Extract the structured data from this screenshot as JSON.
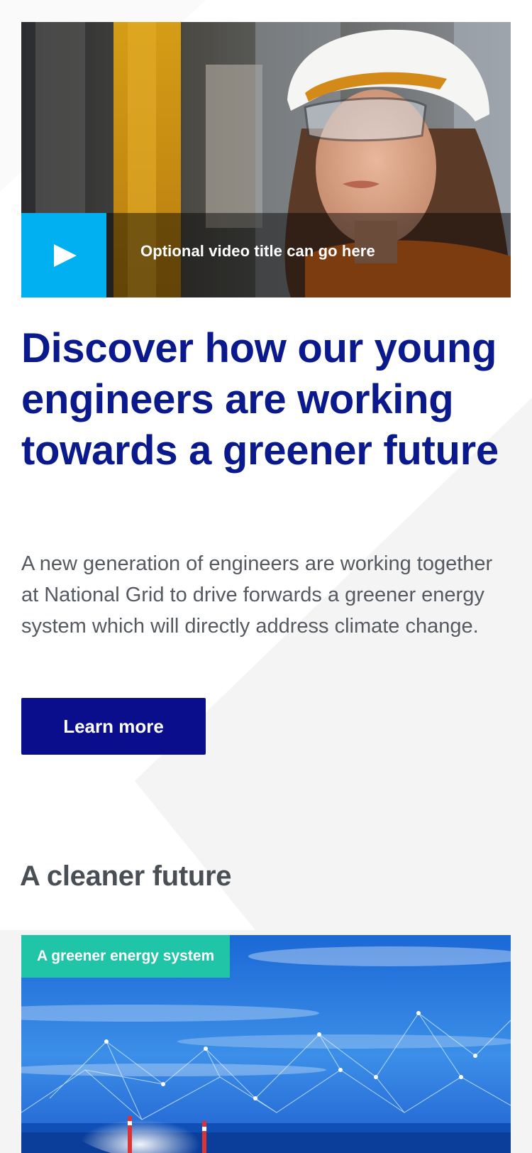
{
  "video": {
    "title": "Optional video title can go here",
    "play_icon": "play-icon",
    "accent_color": "#00b0f0"
  },
  "article": {
    "headline": "Discover how our young engineers are working towards a greener future",
    "body": "A new generation of engineers are working together at National Grid to drive forwards a greener energy system which will directly address climate change.",
    "cta_label": "Learn more"
  },
  "section": {
    "title": "A cleaner future"
  },
  "feature": {
    "tag_label": "A greener energy system",
    "tag_color": "#20c4a6"
  },
  "colors": {
    "headline": "#0a1a8c",
    "button": "#0a0e8c",
    "body_text": "#555a60",
    "page_bg": "#f4f4f4"
  }
}
